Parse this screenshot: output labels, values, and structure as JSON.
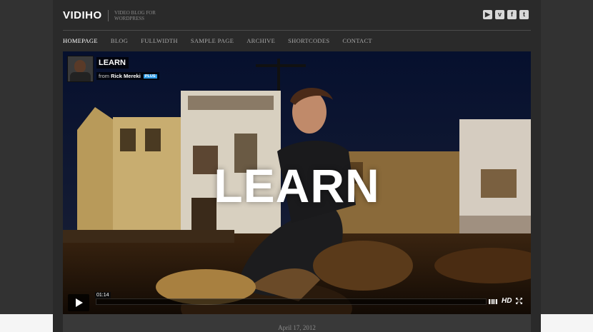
{
  "site": {
    "logo": "VIDIHO",
    "tagline": "VIDEO BLOG FOR WORDPRESS"
  },
  "social": [
    {
      "icon": "youtube-icon",
      "glyph": "▶"
    },
    {
      "icon": "vimeo-icon",
      "glyph": "v"
    },
    {
      "icon": "facebook-icon",
      "glyph": "f"
    },
    {
      "icon": "twitter-icon",
      "glyph": "t"
    }
  ],
  "nav": {
    "items": [
      "HOMEPAGE",
      "BLOG",
      "FULLWIDTH",
      "SAMPLE PAGE",
      "ARCHIVE",
      "SHORTCODES",
      "CONTACT"
    ],
    "active_index": 0
  },
  "video": {
    "title": "LEARN",
    "byline_prefix": "from",
    "author": "Rick Mereki",
    "badge": "PLUS",
    "overlay_title": "LEARN",
    "time": "01:14",
    "hd_label": "HD"
  },
  "post": {
    "date": "April 17, 2012"
  },
  "colors": {
    "background": "#323232",
    "content_background": "#2a2a2a",
    "accent_badge": "#2e9be6"
  }
}
